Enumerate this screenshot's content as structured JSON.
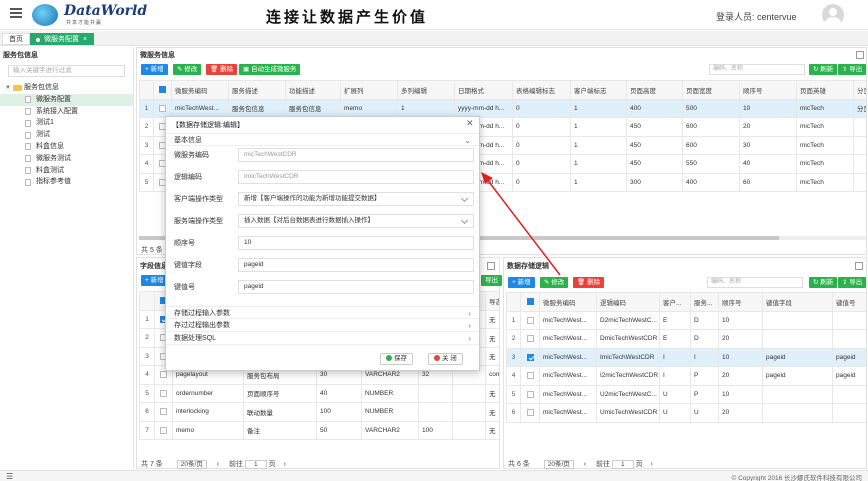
{
  "header": {
    "logo_text": "DataWorld",
    "logo_sub": "共享才能共赢",
    "slogan": "连接让数据产生价值",
    "login_label": "登录人员: centervue"
  },
  "tabs": {
    "home": "首页",
    "active": "微服务配置"
  },
  "sidebar": {
    "title": "服务包信息",
    "search_placeholder": "输入关键字进行过滤",
    "root": "服务包信息",
    "items": [
      "微服务配置",
      "系统接入配置",
      "测试1",
      "测试",
      "料盒信息",
      "微服务测试",
      "料盒测试",
      "指标参考值"
    ]
  },
  "top_panel": {
    "title": "微服务信息",
    "buttons": {
      "add": "新增",
      "edit": "修改",
      "delete": "删除",
      "auto": "自动生成微服务",
      "refresh": "刷新",
      "export": "导出"
    },
    "search_placeholder": "编码、名称",
    "columns": [
      "微服务编码",
      "服务描述",
      "功能描述",
      "扩展列",
      "多列编辑",
      "日期格式",
      "表格编辑标志",
      "客户端标志",
      "页面高度",
      "页面宽度",
      "顺序号",
      "页面英雄",
      "分页"
    ],
    "rows": [
      [
        "micTechWest...",
        "服务包信息",
        "服务包信息",
        "memo",
        "1",
        "yyyy-mm-dd h...",
        "0",
        "1",
        "400",
        "500",
        "10",
        "micTech",
        "分页"
      ],
      [
        "",
        "",
        "",
        "",
        "",
        "yyyy-mm-dd h...",
        "0",
        "1",
        "450",
        "600",
        "20",
        "micTech",
        ""
      ],
      [
        "",
        "",
        "",
        "",
        "",
        "yyyy-mm-dd h...",
        "0",
        "1",
        "450",
        "600",
        "30",
        "micTech",
        ""
      ],
      [
        "",
        "",
        "",
        "",
        "",
        "yyyy-mm-dd h...",
        "0",
        "1",
        "450",
        "550",
        "40",
        "micTech",
        ""
      ],
      [
        "",
        "",
        "",
        "",
        "",
        "yyyy-mm-dd h...",
        "0",
        "1",
        "300",
        "400",
        "60",
        "micTech",
        ""
      ]
    ],
    "total": "共 5 条"
  },
  "field_panel": {
    "title": "字段信息",
    "add": "新增",
    "export": "导出",
    "last_col_header": "导态",
    "rows": [
      {
        "name": "",
        "desc": "",
        "len": "",
        "type": "",
        "prec": "",
        "flag": "无"
      },
      {
        "name": "",
        "desc": "",
        "len": "",
        "type": "",
        "prec": "",
        "flag": "无"
      },
      {
        "name": "",
        "desc": "",
        "len": "",
        "type": "",
        "prec": "",
        "flag": "无"
      },
      {
        "name": "pagelayout",
        "desc": "服务包布局",
        "len": "30",
        "type": "VARCHAR2",
        "prec": "32",
        "flag": "com"
      },
      {
        "name": "ordernumber",
        "desc": "页面顺序号",
        "len": "40",
        "type": "NUMBER",
        "prec": "",
        "flag": "无"
      },
      {
        "name": "interlocking",
        "desc": "联动数量",
        "len": "100",
        "type": "NUMBER",
        "prec": "",
        "flag": "无"
      },
      {
        "name": "memo",
        "desc": "备注",
        "len": "50",
        "type": "VARCHAR2",
        "prec": "100",
        "flag": "无"
      }
    ],
    "total": "共 7 条",
    "page_size": "20条/页",
    "goto": "前往",
    "page": "1",
    "page_suffix": "页"
  },
  "storage_panel": {
    "title": "数据存储逻辑",
    "buttons": {
      "add": "新增",
      "edit": "修改",
      "delete": "删除",
      "refresh": "刷新",
      "export": "导出"
    },
    "search_placeholder": "编码、名称",
    "columns": [
      "微服务编码",
      "逻辑编码",
      "客户...",
      "服务...",
      "顺序号",
      "键值字段",
      "键值号"
    ],
    "rows": [
      [
        "micTechWest...",
        "D2micTechWestC...",
        "E",
        "D",
        "10",
        "",
        ""
      ],
      [
        "micTechWest...",
        "DmicTechWestCDR",
        "E",
        "D",
        "20",
        "",
        ""
      ],
      [
        "micTechWest...",
        "ImicTechWestCDR",
        "I",
        "I",
        "10",
        "pageid",
        "pageid"
      ],
      [
        "micTechWest...",
        "I2micTechWestCDR",
        "I",
        "P",
        "20",
        "pageid",
        "pageid"
      ],
      [
        "micTechWest...",
        "U2micTechWestC...",
        "U",
        "P",
        "10",
        "",
        ""
      ],
      [
        "micTechWest...",
        "UmicTechWestCDR",
        "U",
        "U",
        "20",
        "",
        ""
      ]
    ],
    "total": "共 6 条",
    "page_size": "20条/页",
    "goto": "前往",
    "page": "1",
    "page_suffix": "页"
  },
  "modal": {
    "title": "【数据存储逻辑:编辑】",
    "section_basic": "基本信息",
    "fields": [
      {
        "label": "微服务编码",
        "value": "micTechWestCDR"
      },
      {
        "label": "逻辑编码",
        "value": "ImicTechWestCDR"
      },
      {
        "label": "客户端操作类型",
        "value": "新增【客户端操作的功能为新增功能提交数据】"
      },
      {
        "label": "服务端操作类型",
        "value": "插入数据【对后台数据表进行数据插入操作】"
      },
      {
        "label": "顺序号",
        "value": "10"
      },
      {
        "label": "键值字段",
        "value": "pageid"
      },
      {
        "label": "键值号",
        "value": "pageid"
      }
    ],
    "sections": [
      "存储过程输入参数",
      "存过过程输出参数",
      "数据处理SQL"
    ],
    "save": "保存",
    "close": "关 闭"
  },
  "footer": {
    "copyright": "© Copyright 2016 长沙娜氏软件科技有限公司"
  },
  "colors": {
    "primary_green": "#2bb24c",
    "primary_blue": "#1e88e5",
    "danger": "#e8433a",
    "arrow": "#e02020"
  }
}
